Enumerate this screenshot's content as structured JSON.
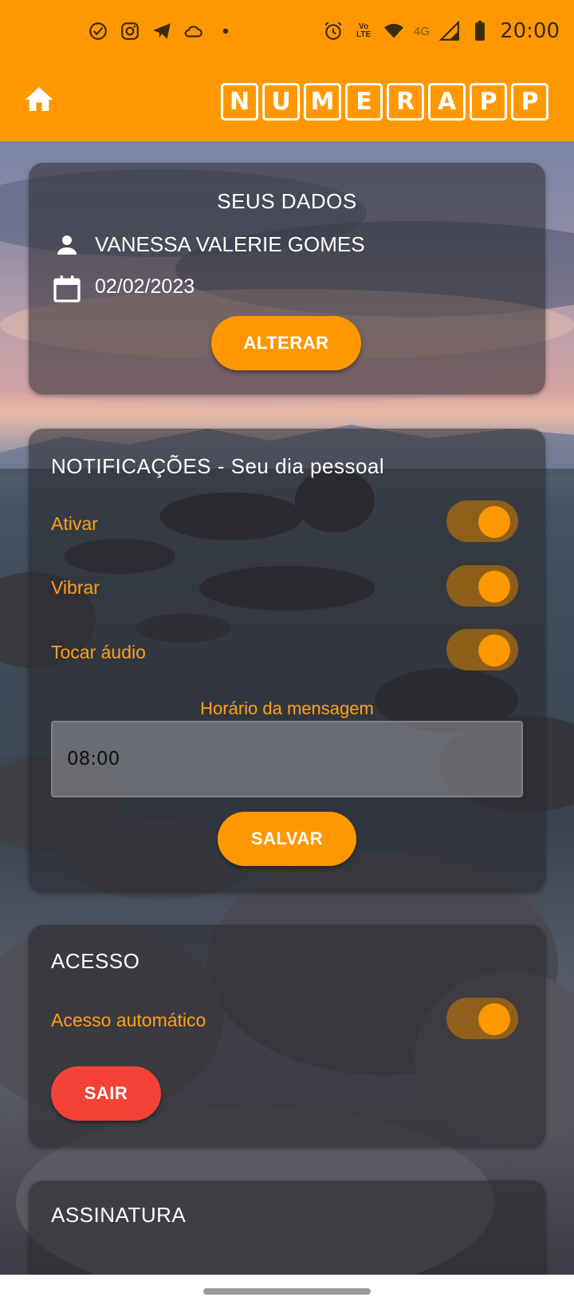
{
  "status_bar": {
    "time": "20:00",
    "left_icons": [
      "check-circle-icon",
      "instagram-icon",
      "telegram-icon",
      "cloud-icon",
      "dot-icon"
    ],
    "right_icons": [
      "alarm-icon",
      "volte-icon",
      "wifi-icon",
      "signal-icon",
      "battery-icon"
    ],
    "lte_line1": "Vo",
    "lte_line2": "LTE",
    "network": "4G"
  },
  "app_bar": {
    "logo_letters": [
      "N",
      "U",
      "M",
      "E",
      "R",
      "A",
      "P",
      "P"
    ],
    "color": "#ff9800"
  },
  "personal_card": {
    "title": "SEUS DADOS",
    "name": "VANESSA VALERIE GOMES",
    "date": "02/02/2023",
    "button": "ALTERAR"
  },
  "notifications_card": {
    "title": "NOTIFICAÇÕES - Seu dia pessoal",
    "toggles": [
      {
        "label": "Ativar",
        "on": true
      },
      {
        "label": "Vibrar",
        "on": true
      },
      {
        "label": "Tocar áudio",
        "on": true
      }
    ],
    "time_label": "Horário da mensagem",
    "time_value": "08:00",
    "button": "SALVAR"
  },
  "access_card": {
    "title": "ACESSO",
    "toggle_label": "Acesso automático",
    "toggle_on": true,
    "button": "SAIR"
  },
  "subscription_card": {
    "title": "ASSINATURA"
  },
  "colors": {
    "accent": "#ff9800",
    "danger": "#f44336",
    "label": "#ff9f1c"
  }
}
